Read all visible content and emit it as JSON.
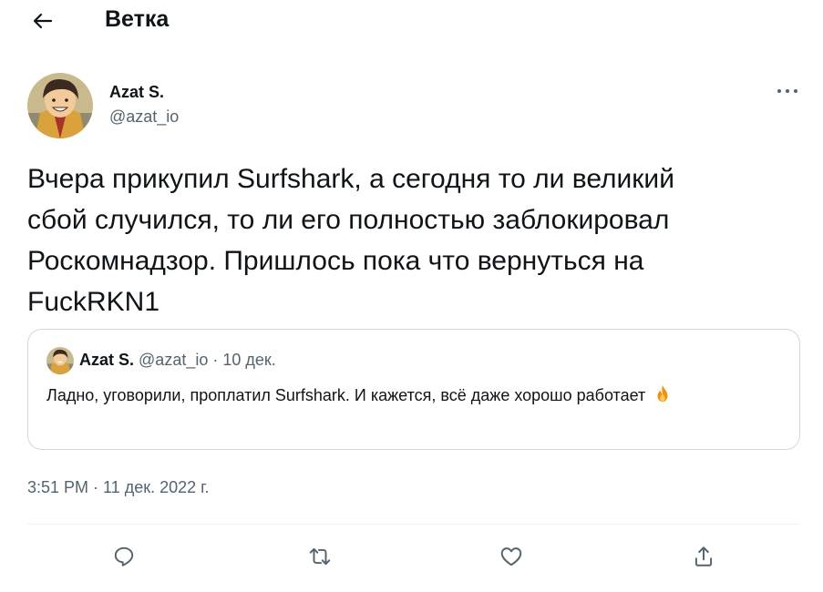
{
  "header": {
    "title": "Ветка",
    "back_icon": "arrow-left-icon"
  },
  "author": {
    "name": "Azat S.",
    "handle": "@azat_io",
    "avatar": "avatar-illustration"
  },
  "tweet": {
    "text": "Вчера прикупил Surfshark, а сегодня то ли великий\nсбой случился, то ли его полностью заблокировал\nРоскомнадзор. Пришлось пока что вернуться на\nFuckRKN1",
    "timestamp": "3:51 PM · 11 дек. 2022 г."
  },
  "quoted_tweet": {
    "name": "Azat S.",
    "handle": "@azat_io",
    "separator": "·",
    "date": "10 дек.",
    "text": "Ладно, уговорили, проплатил Surfshark. И кажется, всё даже хорошо работает",
    "emoji": "🔥"
  },
  "actions": [
    {
      "name": "reply",
      "icon": "reply-icon"
    },
    {
      "name": "retweet",
      "icon": "retweet-icon"
    },
    {
      "name": "like",
      "icon": "heart-icon"
    },
    {
      "name": "share",
      "icon": "share-icon"
    }
  ],
  "colors": {
    "text": "#0f1419",
    "secondary": "#536471",
    "border": "#cfd9de",
    "divider": "#eff3f4"
  }
}
